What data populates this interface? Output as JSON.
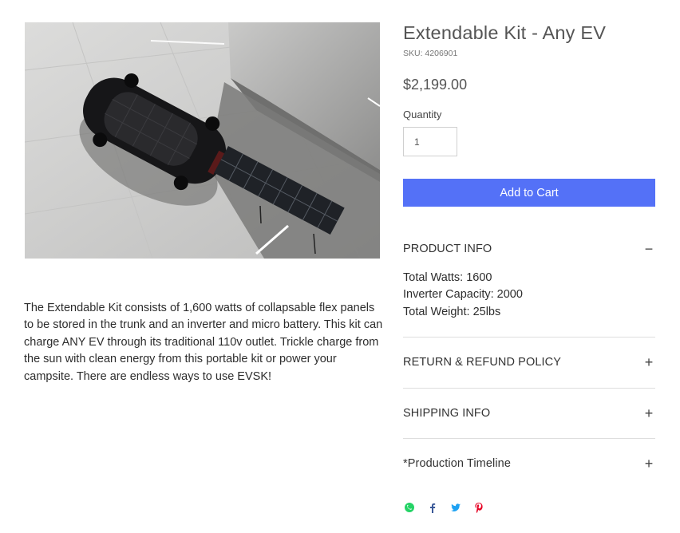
{
  "product": {
    "title": "Extendable Kit - Any EV",
    "sku": "SKU: 4206901",
    "price": "$2,199.00",
    "quantity_label": "Quantity",
    "quantity_value": "1",
    "add_to_cart": "Add to Cart",
    "description": "The Extendable Kit consists of 1,600 watts of collapsable flex panels to be stored in the trunk and an inverter and micro battery.  This kit can charge ANY EV through its traditional 110v outlet.  Trickle charge from the sun with clean energy from this portable kit or power your campsite. There are endless ways to use EVSK!"
  },
  "accordion": [
    {
      "title": "PRODUCT INFO",
      "toggle": "−",
      "expanded": true,
      "lines": [
        "Total Watts: 1600",
        "Inverter Capacity: 2000",
        "Total Weight: 25lbs"
      ]
    },
    {
      "title": "RETURN & REFUND POLICY",
      "toggle": "+",
      "expanded": false
    },
    {
      "title": "SHIPPING INFO",
      "toggle": "+",
      "expanded": false
    },
    {
      "title": "*Production Timeline",
      "toggle": "+",
      "expanded": false
    }
  ],
  "share_icons": [
    {
      "name": "whatsapp-icon",
      "color": "#25d366"
    },
    {
      "name": "facebook-icon",
      "color": "#3b5998"
    },
    {
      "name": "twitter-icon",
      "color": "#1da1f2"
    },
    {
      "name": "pinterest-icon",
      "color": "#e60023"
    }
  ],
  "colors": {
    "accent": "#5471f7"
  }
}
